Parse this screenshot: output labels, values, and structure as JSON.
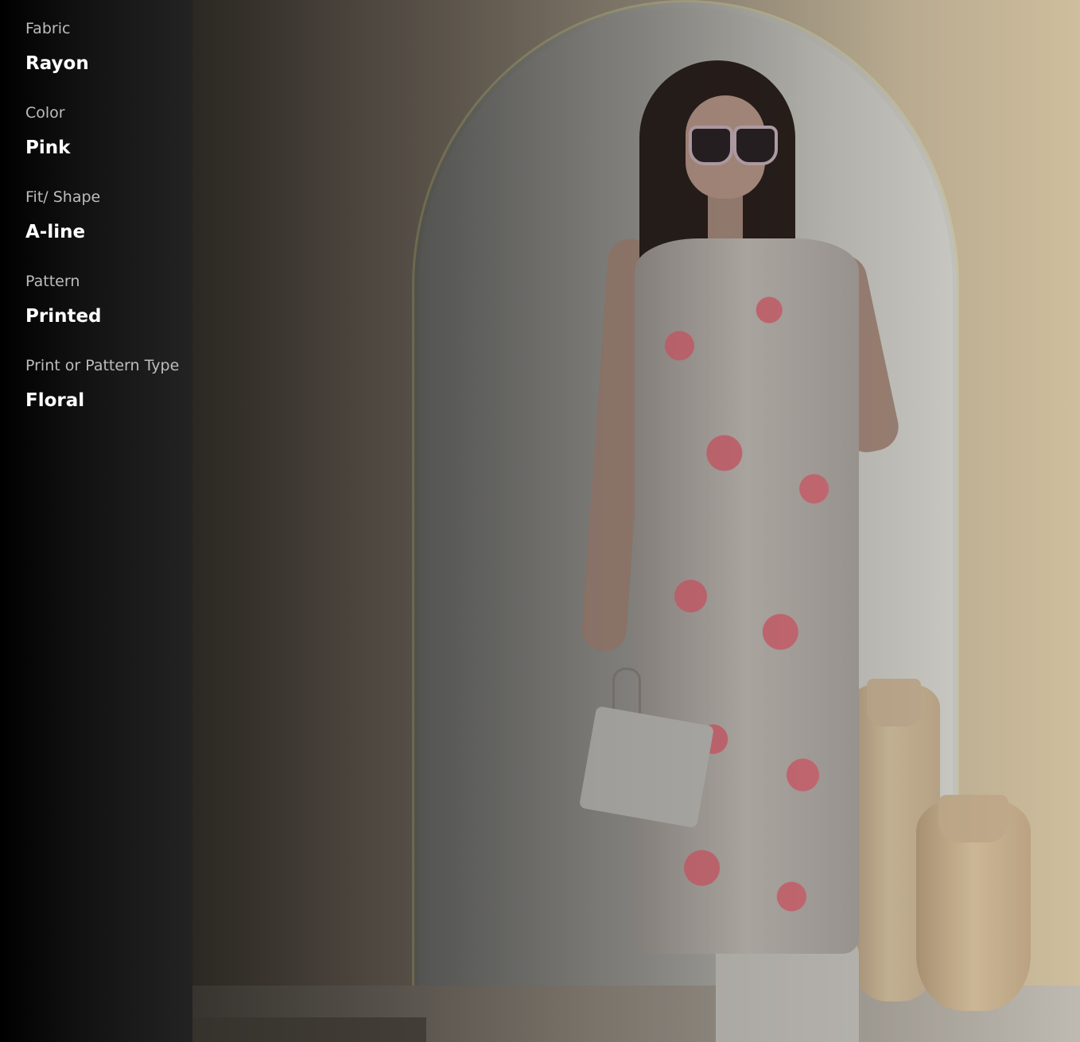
{
  "product": {
    "image_alt": "product photo - woman in pink floral sleeveless kurta",
    "specs": [
      {
        "label": "Fabric",
        "value": "Rayon"
      },
      {
        "label": "Color",
        "value": "Pink"
      },
      {
        "label": "Fit/ Shape",
        "value": "A-line"
      },
      {
        "label": "Pattern",
        "value": "Printed"
      },
      {
        "label": "Print or Pattern Type",
        "value": "Floral"
      }
    ]
  },
  "colors": {
    "panel_bg": "#111111",
    "label_text": "#bdbdbd",
    "value_text": "#ffffff",
    "dress_print": "#d9737d"
  }
}
